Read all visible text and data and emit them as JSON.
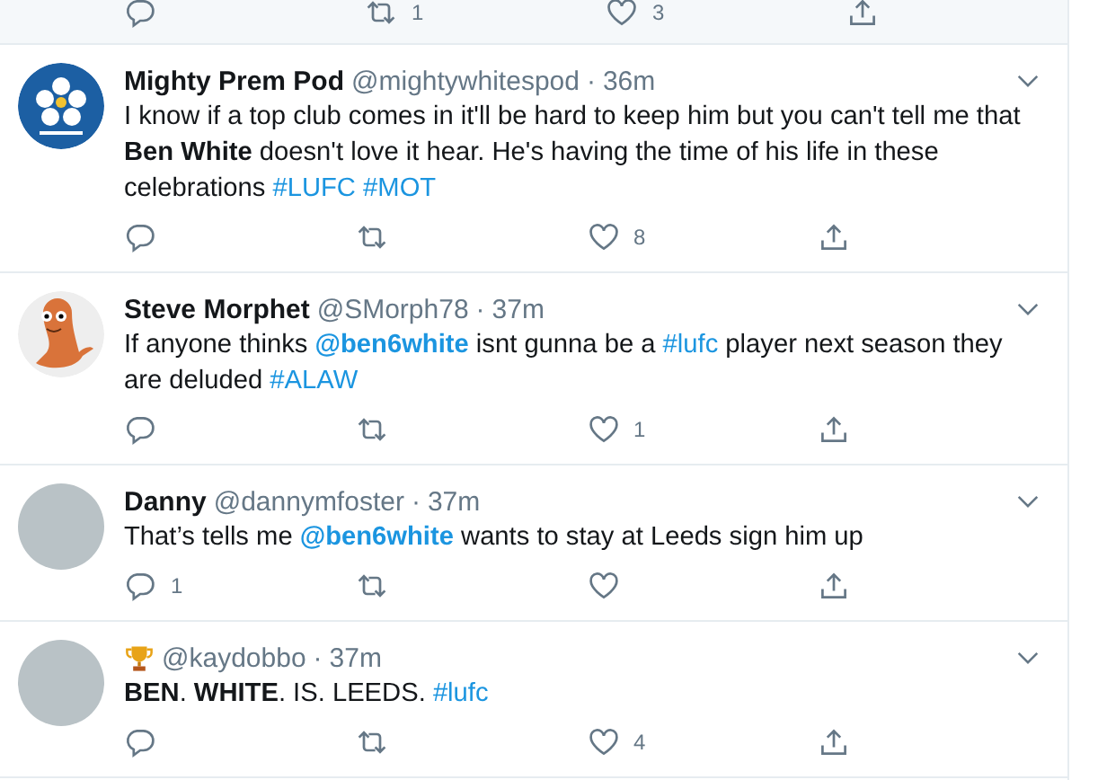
{
  "partial_tweet": {
    "retweets": "1",
    "likes": "3"
  },
  "tweets": [
    {
      "name": "Mighty Prem Pod",
      "handle": "@mightywhitespod",
      "separator": "·",
      "time": "36m",
      "avatar": {
        "kind": "logo"
      },
      "segments": [
        {
          "kind": "plain",
          "text": "I know if a top club comes in it'll be hard to keep him but you can't tell me that "
        },
        {
          "kind": "bold",
          "text": "Ben White"
        },
        {
          "kind": "plain",
          "text": " doesn't love it hear. He's having the time of his life in these celebrations "
        },
        {
          "kind": "hashtag",
          "text": "#LUFC",
          "space_after": true
        },
        {
          "kind": "hashtag",
          "text": "#MOT"
        }
      ],
      "likes": "8"
    },
    {
      "name": "Steve Morphet",
      "handle": "@SMorph78",
      "separator": "·",
      "time": "37m",
      "avatar": {
        "kind": "character"
      },
      "segments": [
        {
          "kind": "plain",
          "text": "If anyone thinks "
        },
        {
          "kind": "mention",
          "text": "@ben6white"
        },
        {
          "kind": "plain",
          "text": " isnt gunna be a "
        },
        {
          "kind": "hashtag",
          "text": "#lufc"
        },
        {
          "kind": "plain",
          "text": " player next season they are deluded "
        },
        {
          "kind": "hashtag",
          "text": "#ALAW"
        }
      ],
      "likes": "1"
    },
    {
      "name": "Danny",
      "handle": "@dannymfoster",
      "separator": "·",
      "time": "37m",
      "avatar": {
        "kind": "photo"
      },
      "segments": [
        {
          "kind": "plain",
          "text": "That’s tells me "
        },
        {
          "kind": "mention",
          "text": "@ben6white"
        },
        {
          "kind": "plain",
          "text": " wants to stay at Leeds sign him up"
        }
      ],
      "replies": "1"
    },
    {
      "name_badge": {
        "kind": "trophy"
      },
      "handle": "@kaydobbo",
      "separator": "·",
      "time": "37m",
      "avatar": {
        "kind": "photo"
      },
      "segments": [
        {
          "kind": "bold",
          "text": "BEN"
        },
        {
          "kind": "plain",
          "text": ". "
        },
        {
          "kind": "bold",
          "text": "WHITE"
        },
        {
          "kind": "plain",
          "text": ". IS. LEEDS. "
        },
        {
          "kind": "hashtag",
          "text": "#lufc"
        }
      ],
      "likes": "4"
    }
  ]
}
